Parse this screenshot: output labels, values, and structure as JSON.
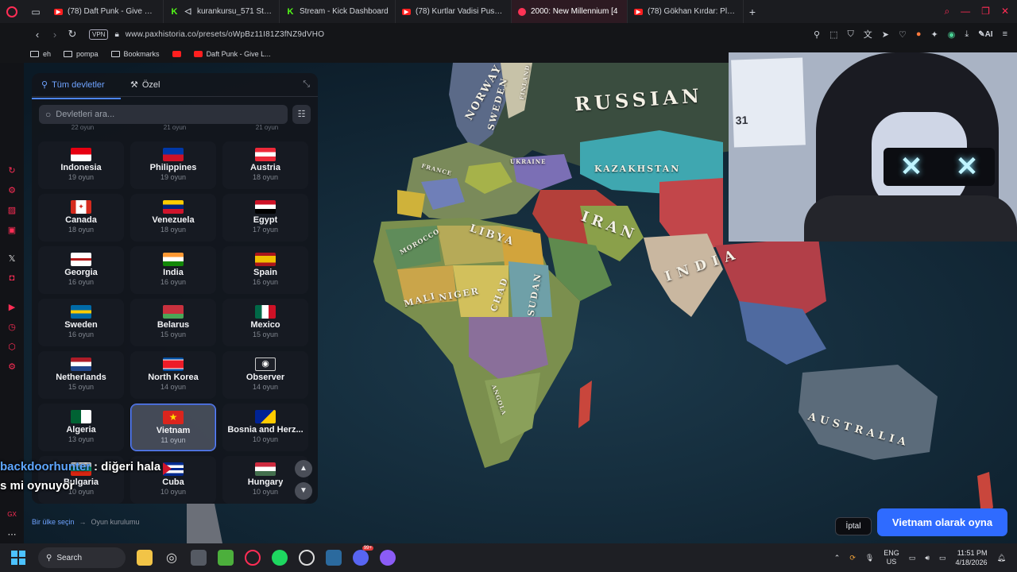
{
  "browser": {
    "tabs": [
      {
        "title": "(78) Daft Punk - Give Life",
        "icon": "youtube-icon",
        "active": false
      },
      {
        "title": "kurankursu_571 Stream",
        "icon": "speaker-icon",
        "active": false
      },
      {
        "title": "Stream - Kick Dashboard",
        "icon": "kick-icon",
        "active": false
      },
      {
        "title": "(78) Kurtlar Vadisi Pusu K",
        "icon": "youtube-icon",
        "active": false
      },
      {
        "title": "2000: New Millennium [4",
        "icon": "paxhistoria-icon",
        "active": true
      },
      {
        "title": "(78) Gökhan Kırdar: Plastik",
        "icon": "youtube-icon",
        "active": false
      }
    ],
    "tab_kick_letter": "K",
    "vpn_label": "VPN",
    "url": "www.paxhistoria.co/presets/oWpBz11I81Z3fNZ9dVHO",
    "ai_label": "AI",
    "bookmarks": [
      {
        "label": "eh",
        "icon": "folder-icon"
      },
      {
        "label": "pompa",
        "icon": "folder-icon"
      },
      {
        "label": "Bookmarks",
        "icon": "folder-icon"
      },
      {
        "label": "",
        "icon": "youtube-icon"
      },
      {
        "label": "Daft Punk - Give L...",
        "icon": "youtube-icon"
      }
    ]
  },
  "map": {
    "labels": {
      "russian": "RUSSIAN",
      "kazakhstan": "KAZAKHSTAN",
      "iran": "IRAN",
      "india": "INDIA",
      "libya": "LIBYA",
      "sudan": "SUDAN",
      "chad": "CHAD",
      "niger": "NIGER",
      "mali": "MALI",
      "australia": "AUSTRALIA",
      "ukraine": "UKRAINE",
      "france": "FRANCE",
      "norway": "NORWAY",
      "sweden": "SWEDEN",
      "finland": "FINLAND",
      "morocco": "MOROCCO",
      "angola": "ANGOLA"
    }
  },
  "webcam": {
    "poster_number": "31"
  },
  "panel": {
    "tab_all": "Tüm devletler",
    "tab_custom": "Özel",
    "search_placeholder": "Devletleri ara...",
    "cut_off_counts": [
      "22 oyun",
      "21 oyun",
      "21 oyun"
    ],
    "countries": [
      {
        "name": "Indonesia",
        "games": "19 oyun",
        "flag": "indonesia"
      },
      {
        "name": "Philippines",
        "games": "19 oyun",
        "flag": "philippines"
      },
      {
        "name": "Austria",
        "games": "18 oyun",
        "flag": "austria"
      },
      {
        "name": "Canada",
        "games": "18 oyun",
        "flag": "canada"
      },
      {
        "name": "Venezuela",
        "games": "18 oyun",
        "flag": "venezuela"
      },
      {
        "name": "Egypt",
        "games": "17 oyun",
        "flag": "egypt"
      },
      {
        "name": "Georgia",
        "games": "16 oyun",
        "flag": "georgia"
      },
      {
        "name": "India",
        "games": "16 oyun",
        "flag": "india"
      },
      {
        "name": "Spain",
        "games": "16 oyun",
        "flag": "spain"
      },
      {
        "name": "Sweden",
        "games": "16 oyun",
        "flag": "sweden"
      },
      {
        "name": "Belarus",
        "games": "15 oyun",
        "flag": "belarus"
      },
      {
        "name": "Mexico",
        "games": "15 oyun",
        "flag": "mexico"
      },
      {
        "name": "Netherlands",
        "games": "15 oyun",
        "flag": "netherlands"
      },
      {
        "name": "North Korea",
        "games": "14 oyun",
        "flag": "northkorea"
      },
      {
        "name": "Observer",
        "games": "14 oyun",
        "flag": "observer"
      },
      {
        "name": "Algeria",
        "games": "13 oyun",
        "flag": "algeria"
      },
      {
        "name": "Vietnam",
        "games": "11 oyun",
        "flag": "vietnam",
        "selected": true
      },
      {
        "name": "Bosnia and Herz...",
        "games": "10 oyun",
        "flag": "bosnia"
      },
      {
        "name": "Bulgaria",
        "games": "10 oyun",
        "flag": "bulgaria"
      },
      {
        "name": "Cuba",
        "games": "10 oyun",
        "flag": "cuba"
      },
      {
        "name": "Hungary",
        "games": "10 oyun",
        "flag": "hungary"
      }
    ]
  },
  "chat": {
    "username": "backdoorhunter",
    "line1_rest": ": diğeri hala",
    "line2": "s mi oynuyor"
  },
  "breadcrumb": {
    "step1": "Bir ülke seçin",
    "step2": "Oyun kurulumu"
  },
  "actions": {
    "cancel": "İptal",
    "play_as": "Vietnam olarak oyna"
  },
  "taskbar": {
    "search_label": "Search",
    "lang_top": "ENG",
    "lang_bottom": "US",
    "time": "11:51 PM",
    "date": "4/18/2026",
    "discord_badge": "99+"
  },
  "colors": {
    "accent": "#2f6bff",
    "opera_red": "#ff2d55",
    "selected_border": "#5f86ff"
  }
}
